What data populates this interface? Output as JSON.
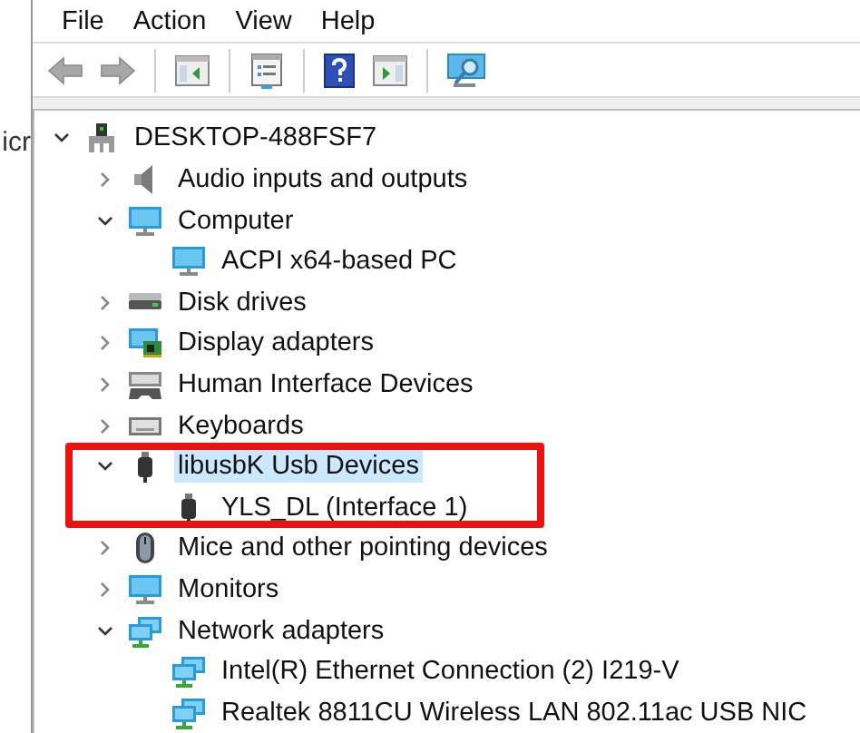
{
  "behind_window": {
    "text": "icr"
  },
  "menu": [
    "File",
    "Action",
    "View",
    "Help"
  ],
  "toolbar": [
    {
      "kind": "back",
      "disabled": true
    },
    {
      "kind": "forward",
      "disabled": true
    },
    {
      "kind": "separator"
    },
    {
      "kind": "show-pane"
    },
    {
      "kind": "separator"
    },
    {
      "kind": "properties"
    },
    {
      "kind": "separator"
    },
    {
      "kind": "help"
    },
    {
      "kind": "run"
    },
    {
      "kind": "separator"
    },
    {
      "kind": "scan"
    }
  ],
  "tree": [
    {
      "label": "DESKTOP-488FSF7",
      "kind": "computer-root",
      "expanded": true,
      "selected": false,
      "children": [
        {
          "label": "Audio inputs and outputs",
          "kind": "speaker",
          "expanded": false,
          "selected": false
        },
        {
          "label": "Computer",
          "kind": "monitor",
          "expanded": true,
          "selected": false,
          "children": [
            {
              "label": "ACPI x64-based PC",
              "kind": "monitor",
              "selected": false
            }
          ]
        },
        {
          "label": "Disk drives",
          "kind": "disk",
          "expanded": false,
          "selected": false
        },
        {
          "label": "Display adapters",
          "kind": "display-adapter",
          "expanded": false,
          "selected": false
        },
        {
          "label": "Human Interface Devices",
          "kind": "hid",
          "expanded": false,
          "selected": false
        },
        {
          "label": "Keyboards",
          "kind": "keyboard",
          "expanded": false,
          "selected": false
        },
        {
          "label": "libusbK Usb Devices",
          "kind": "usb",
          "expanded": true,
          "selected": true,
          "annotated": true,
          "children": [
            {
              "label": "YLS_DL (Interface 1)",
              "kind": "usb",
              "selected": false
            }
          ]
        },
        {
          "label": "Mice and other pointing devices",
          "kind": "mouse",
          "expanded": false,
          "selected": false
        },
        {
          "label": "Monitors",
          "kind": "monitor",
          "expanded": false,
          "selected": false
        },
        {
          "label": "Network adapters",
          "kind": "network",
          "expanded": true,
          "selected": false,
          "children": [
            {
              "label": "Intel(R) Ethernet Connection (2) I219-V",
              "kind": "network",
              "selected": false
            },
            {
              "label": "Realtek 8811CU Wireless LAN 802.11ac USB NIC",
              "kind": "network",
              "selected": false
            }
          ]
        }
      ]
    }
  ]
}
